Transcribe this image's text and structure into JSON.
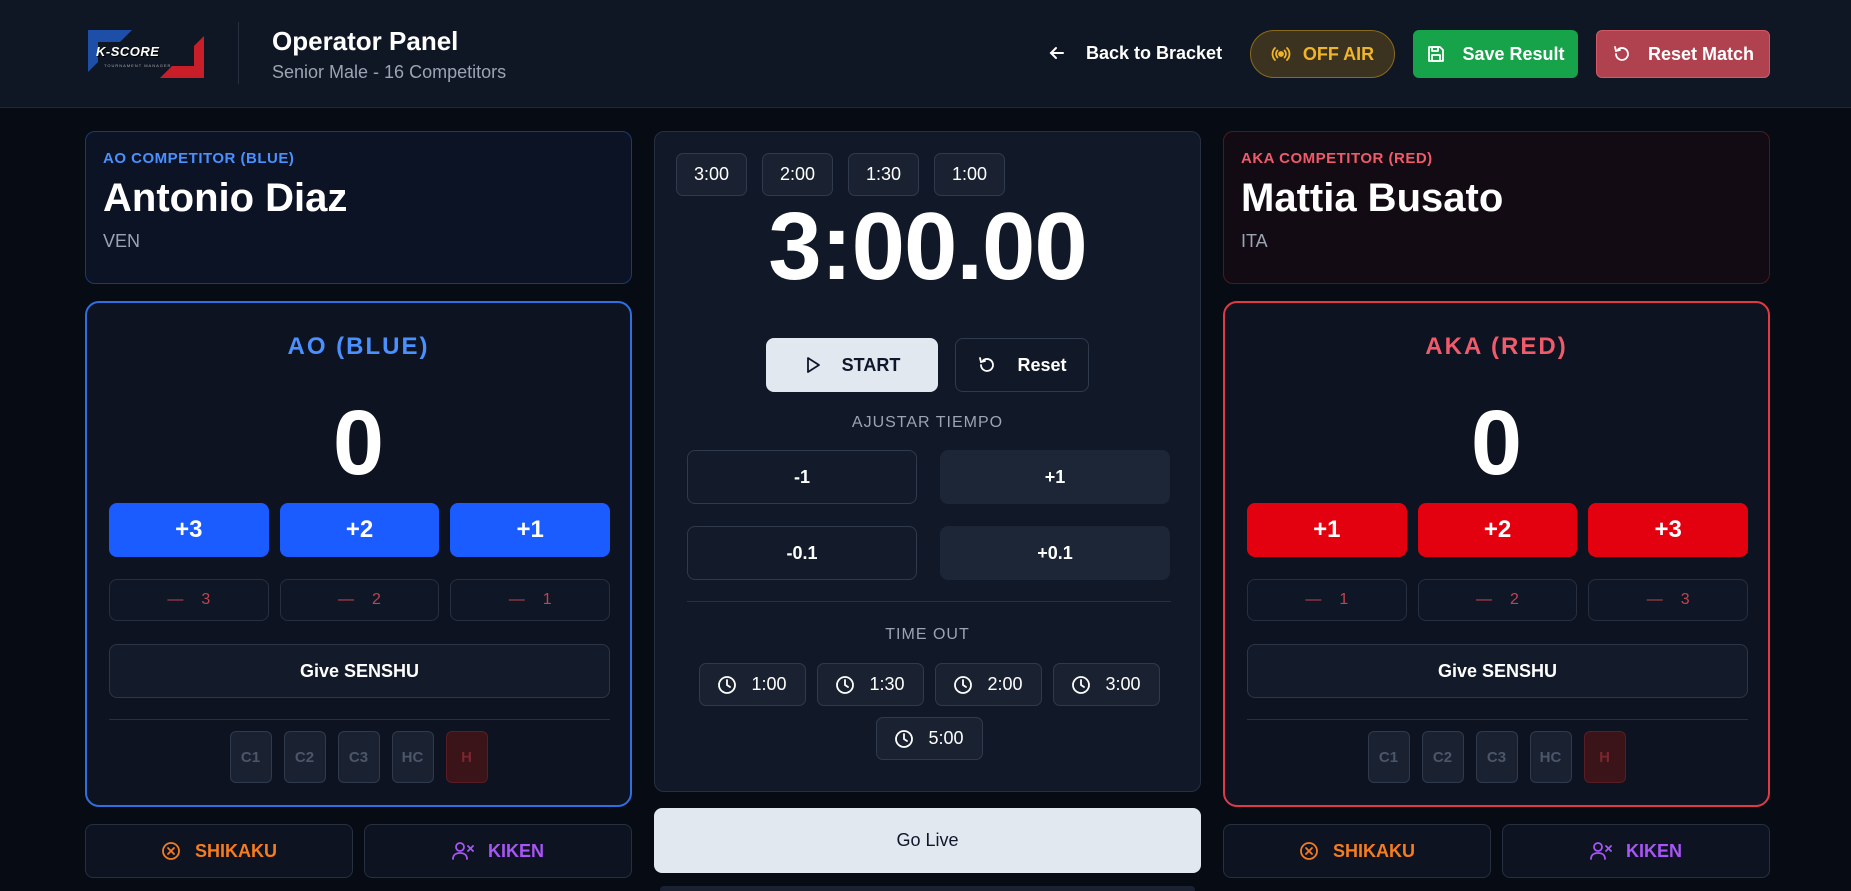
{
  "header": {
    "logo_text": "K-SCORE",
    "logo_sub": "TOURNAMENT MANAGER",
    "title": "Operator Panel",
    "subtitle": "Senior Male - 16 Competitors",
    "back_label": "Back to Bracket",
    "off_air_label": "OFF AIR",
    "save_label": "Save Result",
    "reset_match_label": "Reset Match"
  },
  "ao": {
    "competitor_label": "AO COMPETITOR (BLUE)",
    "name": "Antonio Diaz",
    "country": "VEN",
    "side_title": "AO (BLUE)",
    "score": "0",
    "add_buttons": [
      "+3",
      "+2",
      "+1"
    ],
    "minus_buttons": [
      "3",
      "2",
      "1"
    ],
    "senshu_label": "Give SENSHU",
    "penalties": [
      "C1",
      "C2",
      "C3",
      "HC",
      "H"
    ],
    "shikaku_label": "SHIKAKU",
    "kiken_label": "KIKEN"
  },
  "aka": {
    "competitor_label": "AKA COMPETITOR (RED)",
    "name": "Mattia Busato",
    "country": "ITA",
    "side_title": "AKA (RED)",
    "score": "0",
    "add_buttons": [
      "+1",
      "+2",
      "+3"
    ],
    "minus_buttons": [
      "1",
      "2",
      "3"
    ],
    "senshu_label": "Give SENSHU",
    "penalties": [
      "C1",
      "C2",
      "C3",
      "HC",
      "H"
    ],
    "shikaku_label": "SHIKAKU",
    "kiken_label": "KIKEN"
  },
  "timer": {
    "presets": [
      "3:00",
      "2:00",
      "1:30",
      "1:00"
    ],
    "display": "3:00.00",
    "start_label": "START",
    "reset_label": "Reset",
    "adjust_label": "AJUSTAR TIEMPO",
    "adjust_buttons": [
      "-1",
      "+1",
      "-0.1",
      "+0.1"
    ],
    "timeout_label": "TIME OUT",
    "timeout_buttons": [
      "1:00",
      "1:30",
      "2:00",
      "3:00",
      "5:00"
    ],
    "go_live_label": "Go Live"
  },
  "colors": {
    "ao_accent": "#1a5cff",
    "aka_accent": "#e3000f",
    "save_green": "#16a34a",
    "reset_red": "#b0424f",
    "off_air_amber": "#f0b429",
    "shikaku_orange": "#f57c1f",
    "kiken_purple": "#a855f7"
  }
}
